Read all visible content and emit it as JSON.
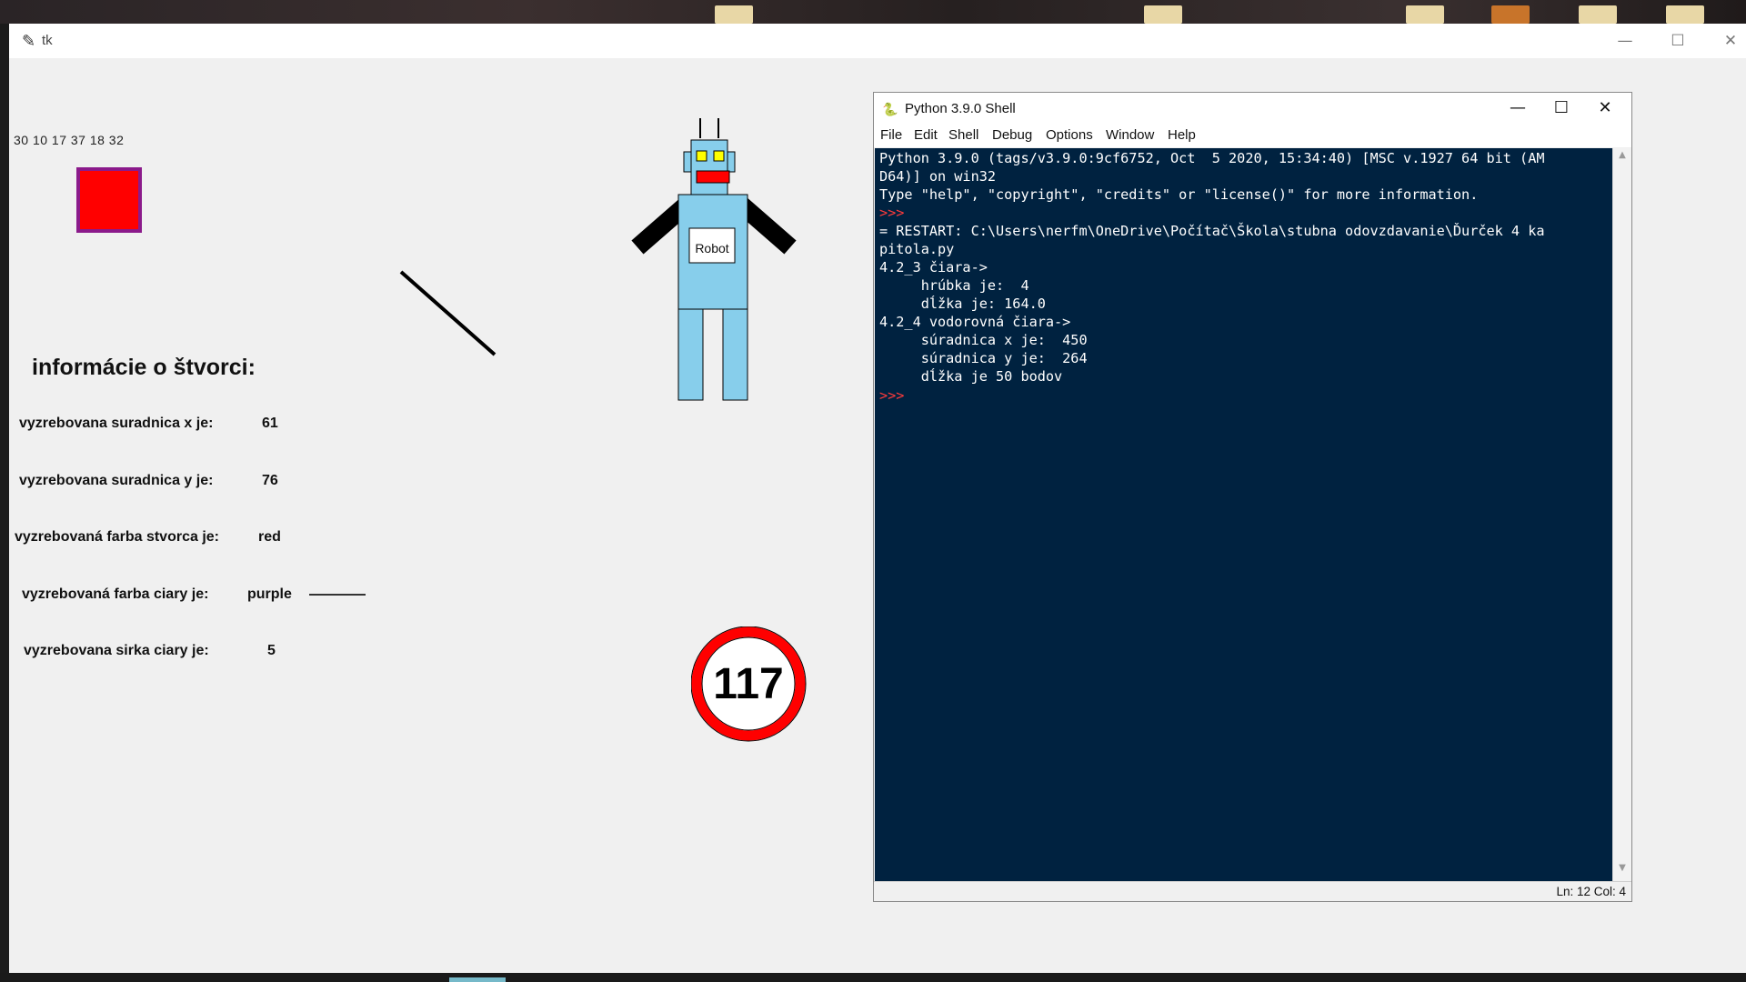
{
  "tk_window": {
    "title": "tk",
    "icon": "feather-icon",
    "controls": {
      "minimize": "—",
      "maximize": "☐",
      "close": "✕"
    },
    "numbers": "30  10  17  37  18  32",
    "square_fill": "#ff0000",
    "square_border": "#8b1a8b",
    "info_title": "informácie o štvorci:",
    "info_rows": [
      {
        "label": "vyzrebovana suradnica x je:",
        "value": "61"
      },
      {
        "label": "vyzrebovana suradnica y je:",
        "value": "76"
      },
      {
        "label": "vyzrebovaná farba stvorca je:",
        "value": "red"
      },
      {
        "label": "vyzrebovaná farba ciary je:",
        "value": "purple"
      },
      {
        "label": "vyzrebovana sirka ciary je:",
        "value": "5"
      }
    ],
    "robot_label": "Robot",
    "sign_number": "117"
  },
  "shell": {
    "title": "Python 3.9.0 Shell",
    "icon": "python-idle-icon",
    "controls": {
      "minimize": "—",
      "maximize": "☐",
      "close": "✕"
    },
    "menu": [
      "File",
      "Edit",
      "Shell",
      "Debug",
      "Options",
      "Window",
      "Help"
    ],
    "console_lines": [
      {
        "text": "Python 3.9.0 (tags/v3.9.0:9cf6752, Oct  5 2020, 15:34:40) [MSC v.1927 64 bit (AM",
        "prompt": false
      },
      {
        "text": "D64)] on win32",
        "prompt": false
      },
      {
        "text": "Type \"help\", \"copyright\", \"credits\" or \"license()\" for more information.",
        "prompt": false
      },
      {
        "text": ">>>",
        "prompt": true
      },
      {
        "text": "= RESTART: C:\\Users\\nerfm\\OneDrive\\Počítač\\Škola\\stubna odovzdavanie\\Ďurček 4 ka",
        "prompt": false
      },
      {
        "text": "pitola.py",
        "prompt": false
      },
      {
        "text": "4.2_3 čiara->",
        "prompt": false
      },
      {
        "text": "     hrúbka je:  4",
        "prompt": false
      },
      {
        "text": "     dĺžka je: 164.0",
        "prompt": false
      },
      {
        "text": "4.2_4 vodorovná čiara->",
        "prompt": false
      },
      {
        "text": "     súradnica x je:  450",
        "prompt": false
      },
      {
        "text": "     súradnica y je:  264",
        "prompt": false
      },
      {
        "text": "     dĺžka je 50 bodov",
        "prompt": false
      },
      {
        "text": ">>>",
        "prompt": true
      }
    ],
    "status": "Ln: 12   Col: 4"
  }
}
